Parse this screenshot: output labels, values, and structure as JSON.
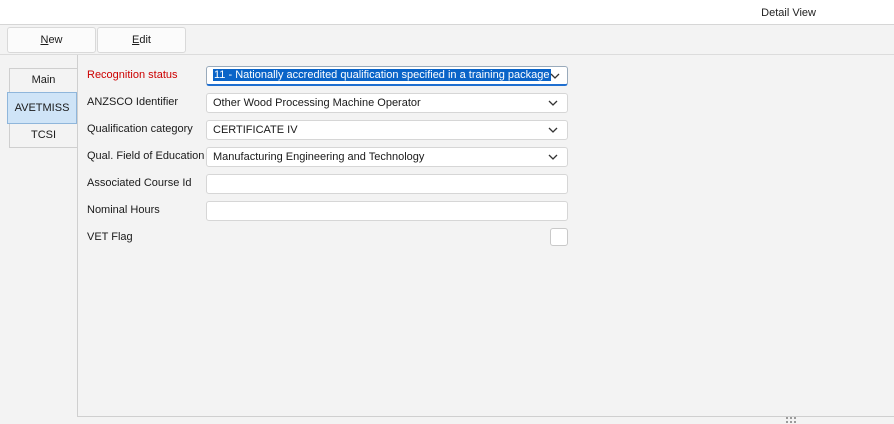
{
  "header": {
    "title": "Detail View"
  },
  "toolbar": {
    "new_prefix": "",
    "new_accel": "N",
    "new_rest": "ew",
    "edit_prefix": "",
    "edit_accel": "E",
    "edit_rest": "dit"
  },
  "tabs": [
    {
      "label": "Main",
      "active": false
    },
    {
      "label": "AVETMISS",
      "active": true
    },
    {
      "label": "TCSI",
      "active": false
    }
  ],
  "form": {
    "recognition_status": {
      "label": "Recognition status",
      "value": "11 - Nationally accredited qualification specified in a training package"
    },
    "anzsco": {
      "label": "ANZSCO Identifier",
      "value": "Other Wood Processing Machine Operator"
    },
    "qual_category": {
      "label": "Qualification category",
      "value": "CERTIFICATE IV"
    },
    "field_of_education": {
      "label": "Qual. Field of Education",
      "value": "Manufacturing Engineering and Technology"
    },
    "associated_course_id": {
      "label": "Associated Course Id",
      "value": ""
    },
    "nominal_hours": {
      "label": "Nominal Hours",
      "value": ""
    },
    "vet_flag": {
      "label": "VET Flag",
      "checked": false
    }
  },
  "colors": {
    "required_label": "#cc0000",
    "selection": "#0a64c8",
    "active_tab": "#cfe4f7"
  },
  "icons": {
    "dropdown": "chevron-down-icon",
    "resize": "resize-grip-icon"
  }
}
